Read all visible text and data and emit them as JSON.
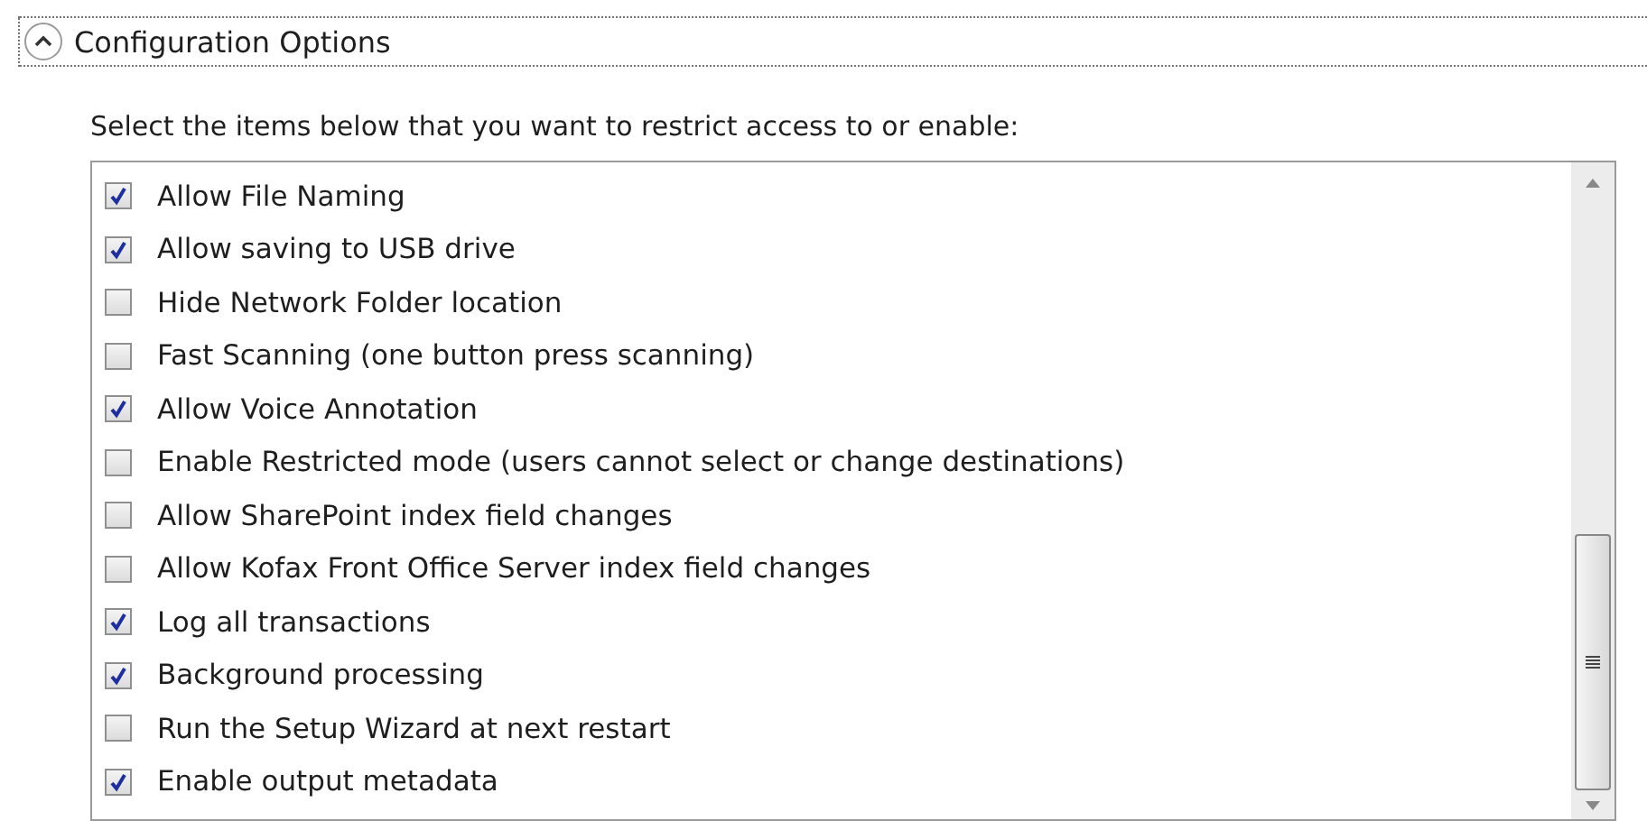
{
  "section": {
    "title": "Configuration Options",
    "expanded": true
  },
  "instruction": "Select the items below that you want to restrict access to or enable:",
  "items": [
    {
      "label": "Allow File Naming",
      "checked": true
    },
    {
      "label": "Allow saving to USB drive",
      "checked": true
    },
    {
      "label": "Hide Network Folder location",
      "checked": false
    },
    {
      "label": "Fast Scanning (one button press scanning)",
      "checked": false
    },
    {
      "label": "Allow Voice Annotation",
      "checked": true
    },
    {
      "label": "Enable Restricted mode (users cannot select or change destinations)",
      "checked": false
    },
    {
      "label": "Allow SharePoint index field changes",
      "checked": false
    },
    {
      "label": "Allow Kofax Front Office Server index field changes",
      "checked": false
    },
    {
      "label": "Log all transactions",
      "checked": true
    },
    {
      "label": "Background processing",
      "checked": true
    },
    {
      "label": "Run the Setup Wizard at next restart",
      "checked": false
    },
    {
      "label": "Enable output metadata",
      "checked": true
    }
  ]
}
